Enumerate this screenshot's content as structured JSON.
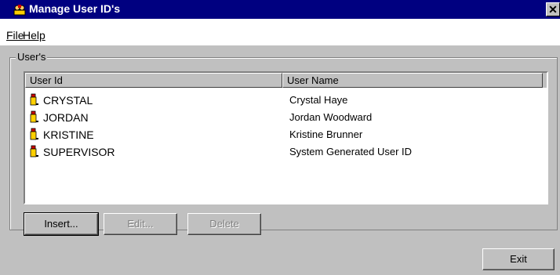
{
  "window": {
    "title": "Manage User ID's",
    "icon": "users-app-icon",
    "close_label": "✕"
  },
  "menu": [
    {
      "label": "File",
      "mnemonic": "F"
    },
    {
      "label": "Help",
      "mnemonic": "H"
    }
  ],
  "users_group": {
    "legend": "User's",
    "columns": [
      "User Id",
      "User Name"
    ],
    "rows": [
      {
        "user_id": "CRYSTAL",
        "user_name": "Crystal Haye",
        "icon": "user-icon"
      },
      {
        "user_id": "JORDAN",
        "user_name": "Jordan Woodward",
        "icon": "user-icon"
      },
      {
        "user_id": "KRISTINE",
        "user_name": "Kristine Brunner",
        "icon": "user-icon"
      },
      {
        "user_id": "SUPERVISOR",
        "user_name": "System Generated User ID",
        "icon": "user-icon"
      }
    ]
  },
  "buttons": {
    "insert": "Insert...",
    "edit": "Edit...",
    "delete": "Delete",
    "exit": "Exit"
  }
}
